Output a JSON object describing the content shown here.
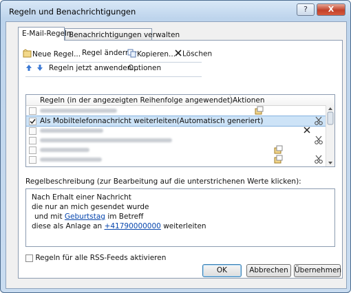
{
  "window": {
    "title": "Regeln und Benachrichtigungen",
    "help_label": "?",
    "close_label": "X"
  },
  "tabs": [
    {
      "label": "E-Mail-Regeln",
      "active": true
    },
    {
      "label": "Benachrichtigungen verwalten",
      "active": false
    }
  ],
  "toolbar": {
    "new_rule": "Neue Regel...",
    "change_rule": "Regel ändern",
    "copy": "Kopieren...",
    "delete": "Löschen",
    "run_now": "Regeln jetzt anwenden...",
    "options": "Optionen"
  },
  "rules_table": {
    "col_rules": "Regeln (in der angezeigten Reihenfolge angewendet)",
    "col_actions": "Aktionen",
    "rows": [
      {
        "label": "",
        "blurred": true,
        "checked": false,
        "action_icons": [
          "forward-icon"
        ]
      },
      {
        "label": "Als Mobiltelefonnachricht weiterleiten(Automatisch generiert)",
        "blurred": false,
        "checked": true,
        "selected": true,
        "action_icons": [
          "scissors-icon"
        ]
      },
      {
        "label": "",
        "blurred": true,
        "checked": false,
        "action_icons": [
          "delete-x-icon"
        ]
      },
      {
        "label": "",
        "blurred": true,
        "checked": false,
        "action_icons": [
          "scissors-icon"
        ]
      },
      {
        "label": "",
        "blurred": true,
        "checked": false,
        "action_icons": [
          "forward-icon"
        ]
      },
      {
        "label": "",
        "blurred": true,
        "checked": false,
        "action_icons": [
          "forward-icon"
        ]
      },
      {
        "label": "",
        "blurred": true,
        "checked": false,
        "action_icons": [
          "scissors-icon"
        ]
      }
    ]
  },
  "description": {
    "label": "Regelbeschreibung (zur Bearbeitung auf die unterstrichenen Werte klicken):",
    "line1": "Nach Erhalt einer Nachricht",
    "line2": "die nur an mich gesendet wurde",
    "line3_pre": "und mit",
    "line3_link": "Geburtstag",
    "line3_post": "im Betreff",
    "line4_pre": "diese als Anlage an",
    "line4_link": "+41790000000",
    "line4_post": "weiterleiten"
  },
  "rss_checkbox": {
    "label": "Regeln für alle RSS-Feeds aktivieren",
    "checked": false
  },
  "buttons": {
    "ok": "OK",
    "cancel": "Abbrechen",
    "apply": "Übernehmen"
  }
}
